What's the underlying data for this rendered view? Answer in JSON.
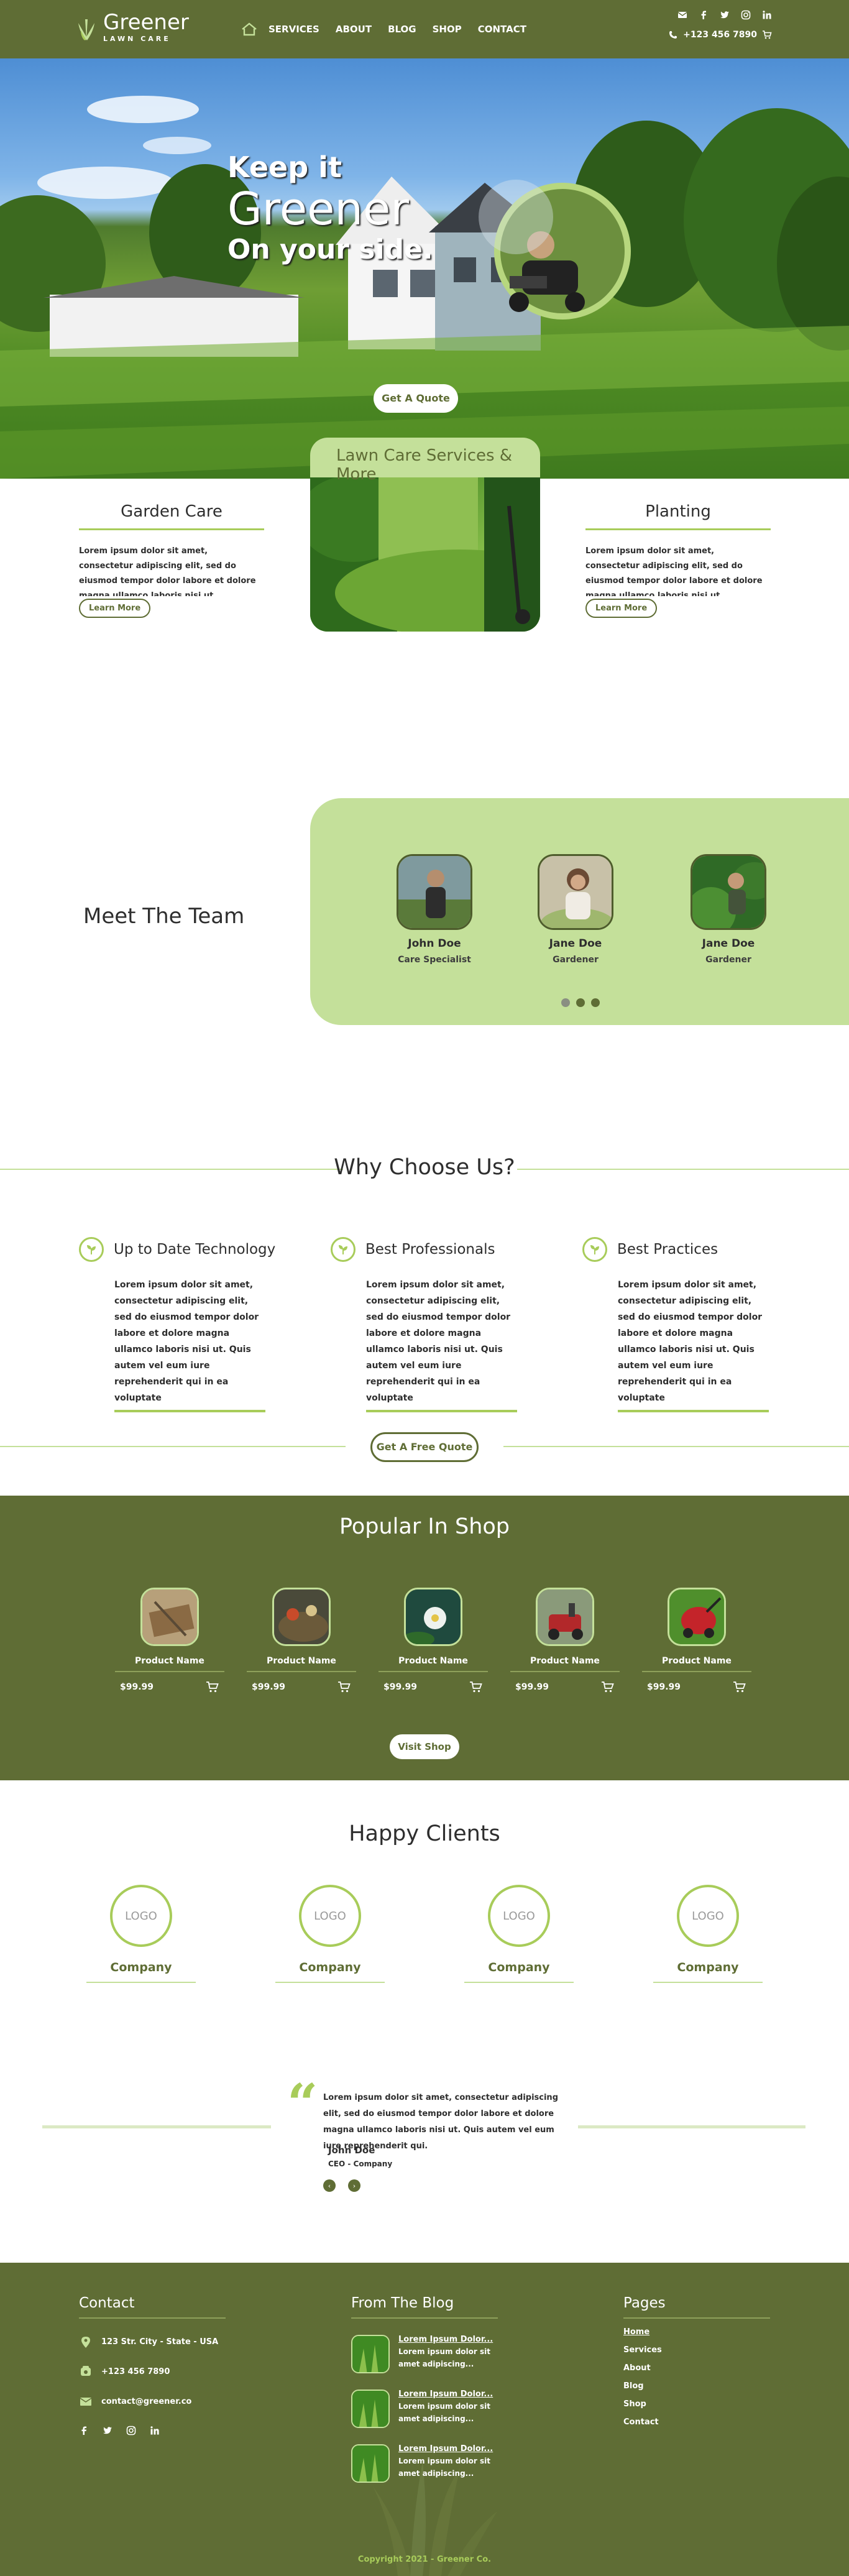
{
  "brand": {
    "name": "Greener",
    "tagline": "LAWN CARE"
  },
  "nav": {
    "items": [
      "SERVICES",
      "ABOUT",
      "BLOG",
      "SHOP",
      "CONTACT"
    ]
  },
  "header": {
    "phone": "+123 456 7890"
  },
  "hero": {
    "line1": "Keep it",
    "line2": "Greener",
    "line3": "On your side.",
    "cta": "Get A Quote"
  },
  "services": {
    "image_label": "Lawn Care Services & More",
    "items": [
      {
        "title": "Garden Care",
        "text": "Lorem ipsum dolor sit amet, consectetur adipiscing elit, sed do eiusmod tempor dolor labore et dolore magna ullamco laboris nisi ut",
        "cta": "Learn More"
      },
      {
        "title": "Planting",
        "text": "Lorem ipsum dolor sit amet, consectetur adipiscing elit, sed do eiusmod tempor dolor labore et dolore magna ullamco laboris nisi ut",
        "cta": "Learn More"
      }
    ]
  },
  "team": {
    "title": "Meet The Team",
    "members": [
      {
        "name": "John Doe",
        "role": "Care Specialist"
      },
      {
        "name": "Jane Doe",
        "role": "Gardener"
      },
      {
        "name": "Jane Doe",
        "role": "Gardener"
      }
    ]
  },
  "why": {
    "title": "Why Choose Us?",
    "items": [
      {
        "title": "Up to Date Technology",
        "text": "Lorem ipsum dolor sit amet, consectetur adipiscing elit, sed do eiusmod tempor dolor  labore et dolore magna ullamco laboris nisi ut. Quis autem vel eum iure reprehenderit qui in ea voluptate"
      },
      {
        "title": "Best Professionals",
        "text": "Lorem ipsum dolor sit amet, consectetur adipiscing elit, sed do eiusmod tempor dolor  labore et dolore magna ullamco laboris nisi ut. Quis autem vel eum iure reprehenderit qui in ea voluptate"
      },
      {
        "title": "Best Practices",
        "text": "Lorem ipsum dolor sit amet, consectetur adipiscing elit, sed do eiusmod tempor dolor  labore et dolore magna ullamco laboris nisi ut. Quis autem vel eum iure reprehenderit qui in ea voluptate"
      }
    ],
    "cta": "Get A Free Quote"
  },
  "shop": {
    "title": "Popular In Shop",
    "products": [
      {
        "name": "Product Name",
        "price": "$99.99"
      },
      {
        "name": "Product Name",
        "price": "$99.99"
      },
      {
        "name": "Product Name",
        "price": "$99.99"
      },
      {
        "name": "Product Name",
        "price": "$99.99"
      },
      {
        "name": "Product Name",
        "price": "$99.99"
      }
    ],
    "cta": "Visit Shop"
  },
  "clients": {
    "title": "Happy Clients",
    "logo_text": "LOGO",
    "items": [
      "Company",
      "Company",
      "Company",
      "Company"
    ],
    "testimonial": {
      "text": "Lorem ipsum dolor sit amet, consectetur adipiscing elit, sed do eiusmod tempor dolor  labore et dolore magna ullamco laboris nisi ut. Quis autem vel eum iure reprehenderit qui.",
      "name": "John Doe",
      "role": "CEO - Company"
    }
  },
  "footer": {
    "contact": {
      "title": "Contact",
      "address": "123 Str. City - State - USA",
      "phone": "+123 456 7890",
      "email": "contact@greener.co"
    },
    "blog": {
      "title": "From The Blog",
      "posts": [
        {
          "title": "Lorem Ipsum Dolor...",
          "excerpt": "Lorem ipsum dolor sit amet adipiscing..."
        },
        {
          "title": "Lorem Ipsum Dolor...",
          "excerpt": "Lorem ipsum dolor sit amet adipiscing..."
        },
        {
          "title": "Lorem Ipsum Dolor...",
          "excerpt": "Lorem ipsum dolor sit amet adipiscing..."
        }
      ]
    },
    "pages": {
      "title": "Pages",
      "links": [
        "Home",
        "Services",
        "About",
        "Blog",
        "Shop",
        "Contact"
      ]
    },
    "copyright": "Copyright 2021 - Greener Co."
  },
  "colors": {
    "olive": "#5f6d35",
    "light_green": "#c4e09a",
    "accent": "#a8cc5a"
  },
  "icons": [
    "grass-logo-icon",
    "home-icon",
    "mail-icon",
    "facebook-icon",
    "twitter-icon",
    "instagram-icon",
    "linkedin-icon",
    "phone-icon",
    "cart-icon",
    "sprout-icon",
    "location-icon",
    "quote-icon"
  ]
}
